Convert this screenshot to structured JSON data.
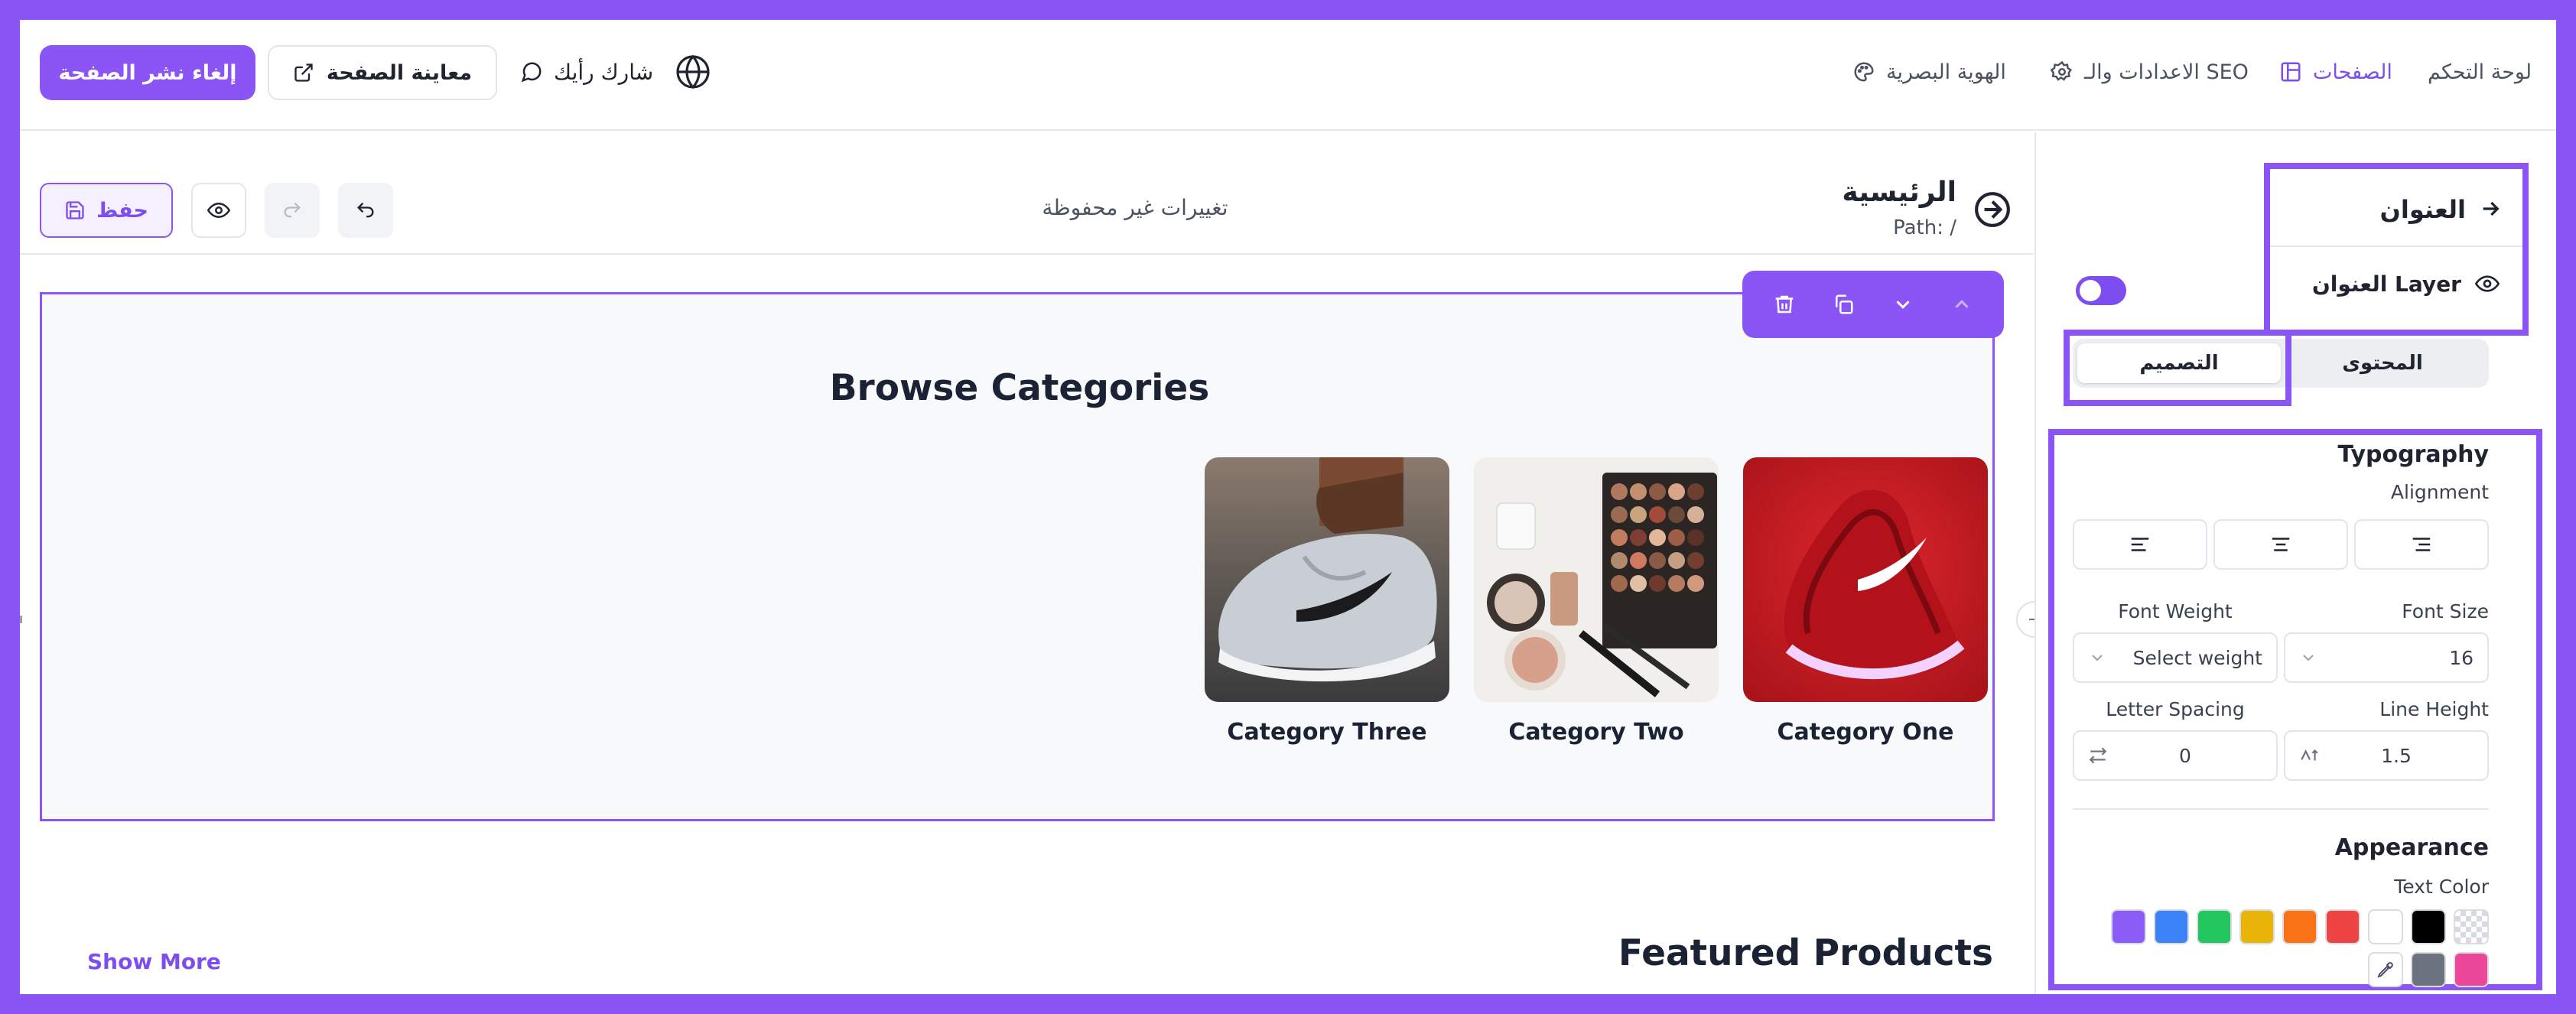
{
  "topbar": {
    "nav": {
      "dashboard": "لوحة التحكم",
      "pages": "الصفحات",
      "settings": "الاعدادات والـ SEO",
      "identity": "الهوية البصرية"
    },
    "unpublish_label": "إلغاء نشر الصفحة",
    "preview_label": "معاينة الصفحة",
    "feedback_label": "شارك رأيك"
  },
  "editor": {
    "save_label": "حفظ",
    "unsaved_text": "تغييرات غير محفوظة",
    "page_name": "الرئيسية",
    "page_path": "Path: /"
  },
  "canvas": {
    "block_title": "Browse Categories",
    "categories": [
      {
        "label": "Category One",
        "image": "red-sneaker"
      },
      {
        "label": "Category Two",
        "image": "makeup-palette"
      },
      {
        "label": "Category Three",
        "image": "grey-sneaker"
      }
    ],
    "featured_title": "Featured Products",
    "show_more_label": "Show More"
  },
  "panel": {
    "element_title": "العنوان",
    "layer_label": "العنوان Layer",
    "layer_visible": false,
    "tabs": {
      "content": "المحتوى",
      "design": "التصميم"
    },
    "active_tab": "design",
    "typography": {
      "title": "Typography",
      "alignment_label": "Alignment",
      "font_weight_label": "Font Weight",
      "font_weight_placeholder": "Select weight",
      "font_size_label": "Font Size",
      "font_size_value": "16",
      "letter_spacing_label": "Letter Spacing",
      "letter_spacing_value": "0",
      "line_height_label": "Line Height",
      "line_height_value": "1.5"
    },
    "appearance": {
      "title": "Appearance",
      "text_color_label": "Text Color",
      "colors_row1": [
        "transparent",
        "#000000",
        "#ffffff",
        "#ef4444",
        "#f97316",
        "#eab308",
        "#22c55e",
        "#3b82f6",
        "#8b5cf6"
      ],
      "colors_row2": [
        "#ec4899",
        "#6b7280",
        "picker"
      ]
    }
  },
  "colors": {
    "accent": "#8b55f5",
    "frame": "#8b55f5"
  }
}
